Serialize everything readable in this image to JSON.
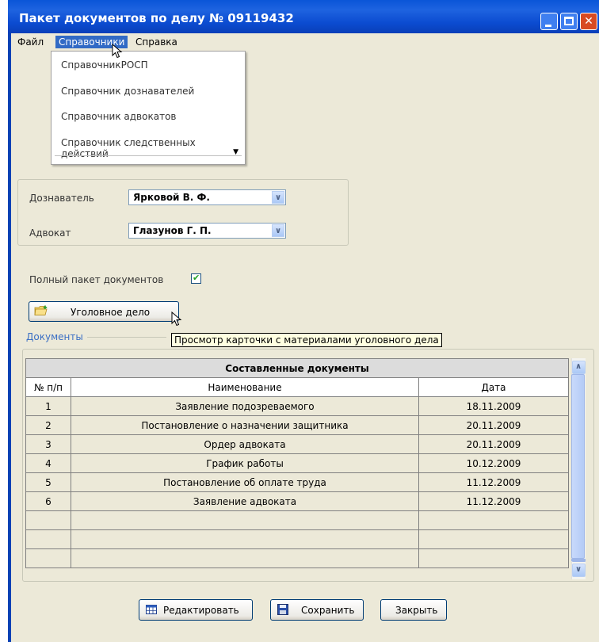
{
  "window": {
    "title": "Пакет документов по делу № 09119432"
  },
  "menu": {
    "file": "Файл",
    "references": "Справочники",
    "help": "Справка"
  },
  "dropdown": {
    "items": [
      "СправочникРОСП",
      "Справочник дознавателей",
      "Справочник адвокатов",
      "Справочник следственных действий"
    ],
    "more_arrow": "▼"
  },
  "form": {
    "investigator_label": "Дознаватель",
    "investigator_value": "Ярковой В. Ф.",
    "lawyer_label": "Адвокат",
    "lawyer_value": "Глазунов Г. П.",
    "full_package_label": "Полный пакет документов",
    "full_package_checked": true,
    "case_button_label": "Уголовное дело",
    "tooltip": "Просмотр карточки с материалами уголовного дела"
  },
  "documents": {
    "section_label": "Документы",
    "table_caption": "Составленные документы",
    "columns": [
      "№ п/п",
      "Наименование",
      "Дата"
    ],
    "rows": [
      [
        "1",
        "Заявление подозреваемого",
        "18.11.2009"
      ],
      [
        "2",
        "Постановление о назначении защитника",
        "20.11.2009"
      ],
      [
        "3",
        "Ордер адвоката",
        "20.11.2009"
      ],
      [
        "4",
        "График работы",
        "10.12.2009"
      ],
      [
        "5",
        "Постановление об оплате труда",
        "11.12.2009"
      ],
      [
        "6",
        "Заявление адвоката",
        "11.12.2009"
      ],
      [
        "",
        "",
        ""
      ],
      [
        "",
        "",
        ""
      ],
      [
        "",
        "",
        ""
      ]
    ]
  },
  "buttons": {
    "edit": "Редактировать",
    "save": "Сохранить",
    "close": "Закрыть"
  },
  "icons": {
    "folder": "folder-add-icon",
    "edit": "grid-icon",
    "save": "floppy-disk-icon"
  },
  "colors": {
    "titlebar": "#0a55d8",
    "window_bg": "#ece9d8",
    "menu_highlight": "#316ac5",
    "tooltip_bg": "#ffffe1",
    "section_label": "#3b6fc4"
  }
}
